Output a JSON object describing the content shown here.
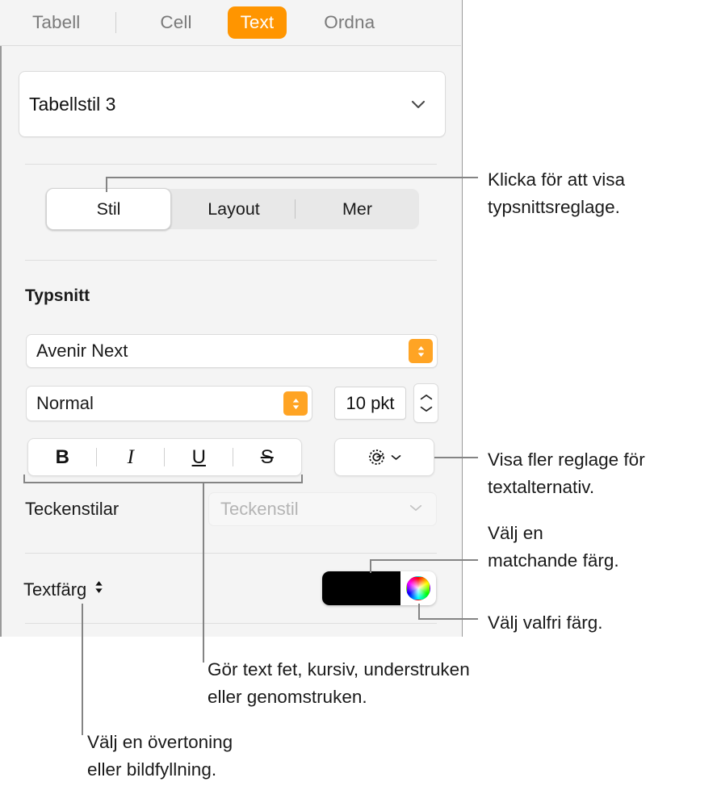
{
  "window": {
    "title": "Text inspector",
    "panel_background": "#f4f4f4",
    "accent_color": "#ff9500"
  },
  "tabs": [
    {
      "label": "Tabell",
      "selected": false
    },
    {
      "label": "Cell",
      "selected": false
    },
    {
      "label": "Text",
      "selected": true
    },
    {
      "label": "Ordna",
      "selected": false
    }
  ],
  "style_popup": {
    "value": "Tabellstil 3",
    "icon": "chevron-down-icon"
  },
  "segmented_control": {
    "items": [
      {
        "label": "Stil",
        "selected": true
      },
      {
        "label": "Layout",
        "selected": false
      },
      {
        "label": "Mer",
        "selected": false
      }
    ]
  },
  "font_section": {
    "title": "Typsnitt",
    "family": {
      "value": "Avenir Next",
      "icon": "up-down-stepper-icon"
    },
    "weight": {
      "value": "Normal",
      "icon": "up-down-stepper-icon"
    },
    "size": {
      "value": "10 pkt",
      "icon": "stepper-icon"
    },
    "style_buttons": [
      {
        "label": "B",
        "name": "bold"
      },
      {
        "label": "I",
        "name": "italic"
      },
      {
        "label": "U",
        "name": "underline"
      },
      {
        "label": "S",
        "name": "strikethrough"
      }
    ],
    "options_button": {
      "icon": "gear-icon",
      "chevron": "chevron-down-icon"
    }
  },
  "character_styles": {
    "label": "Teckenstilar",
    "select_placeholder": "Teckenstil",
    "select_enabled": false,
    "icon": "chevron-down-icon"
  },
  "text_color": {
    "label": "Textfärg",
    "icon": "up-down-chevron-icon",
    "swatch_color": "#000000",
    "wheel_button": "color-wheel-icon"
  },
  "annotations": [
    {
      "id": "a1",
      "text": "Klicka för att visa\ntypsnittsreglage."
    },
    {
      "id": "a2",
      "text": "Visa fler reglage för\ntextalternativ."
    },
    {
      "id": "a3",
      "text": "Välj en\nmatchande färg."
    },
    {
      "id": "a4",
      "text": "Välj valfri färg."
    },
    {
      "id": "a5",
      "text": "Gör text fet, kursiv, understruken\neller genomstruken."
    },
    {
      "id": "a6",
      "text": "Välj en övertoning\neller bildfyllning."
    }
  ]
}
